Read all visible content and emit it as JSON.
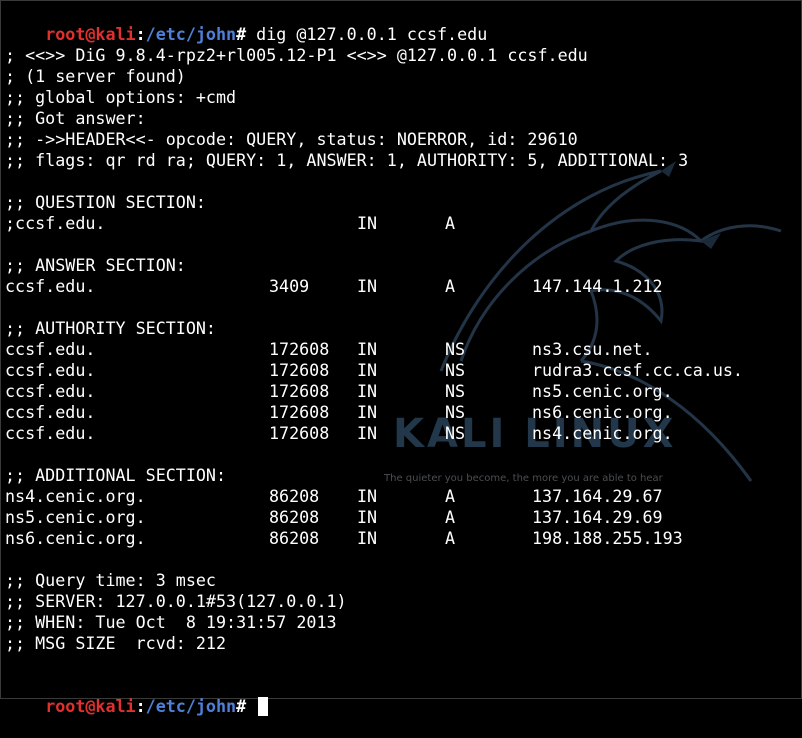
{
  "terminal": {
    "colors": {
      "background": "#000000",
      "text": "#ffffff",
      "prompt_user": "#e03030",
      "prompt_path": "#4f80d8"
    },
    "prompt": {
      "user_host": "root@kali",
      "separator": ":",
      "path": "/etc/john",
      "symbol": "# "
    },
    "command": "dig @127.0.0.1 ccsf.edu",
    "header_lines": [
      "; <<>> DiG 9.8.4-rpz2+rl005.12-P1 <<>> @127.0.0.1 ccsf.edu",
      "; (1 server found)",
      ";; global options: +cmd",
      ";; Got answer:",
      ";; ->>HEADER<<- opcode: QUERY, status: NOERROR, id: 29610",
      ";; flags: qr rd ra; QUERY: 1, ANSWER: 1, AUTHORITY: 5, ADDITIONAL: 3"
    ],
    "question_section": {
      "title": ";; QUESTION SECTION:",
      "row": {
        "name": ";ccsf.edu.",
        "class": "IN",
        "type": "A"
      }
    },
    "answer_section": {
      "title": ";; ANSWER SECTION:",
      "rows": [
        {
          "name": "ccsf.edu.",
          "ttl": "3409",
          "class": "IN",
          "type": "A",
          "data": "147.144.1.212"
        }
      ]
    },
    "authority_section": {
      "title": ";; AUTHORITY SECTION:",
      "rows": [
        {
          "name": "ccsf.edu.",
          "ttl": "172608",
          "class": "IN",
          "type": "NS",
          "data": "ns3.csu.net."
        },
        {
          "name": "ccsf.edu.",
          "ttl": "172608",
          "class": "IN",
          "type": "NS",
          "data": "rudra3.ccsf.cc.ca.us."
        },
        {
          "name": "ccsf.edu.",
          "ttl": "172608",
          "class": "IN",
          "type": "NS",
          "data": "ns5.cenic.org."
        },
        {
          "name": "ccsf.edu.",
          "ttl": "172608",
          "class": "IN",
          "type": "NS",
          "data": "ns6.cenic.org."
        },
        {
          "name": "ccsf.edu.",
          "ttl": "172608",
          "class": "IN",
          "type": "NS",
          "data": "ns4.cenic.org."
        }
      ]
    },
    "additional_section": {
      "title": ";; ADDITIONAL SECTION:",
      "rows": [
        {
          "name": "ns4.cenic.org.",
          "ttl": "86208",
          "class": "IN",
          "type": "A",
          "data": "137.164.29.67"
        },
        {
          "name": "ns5.cenic.org.",
          "ttl": "86208",
          "class": "IN",
          "type": "A",
          "data": "137.164.29.69"
        },
        {
          "name": "ns6.cenic.org.",
          "ttl": "86208",
          "class": "IN",
          "type": "A",
          "data": "198.188.255.193"
        }
      ]
    },
    "footer_lines": [
      ";; Query time: 3 msec",
      ";; SERVER: 127.0.0.1#53(127.0.0.1)",
      ";; WHEN: Tue Oct  8 19:31:57 2013",
      ";; MSG SIZE  rcvd: 212"
    ],
    "watermark": {
      "logo_text": "KALI LINUX",
      "tagline": "The quieter you become, the more you are able to hear",
      "icon": "kali-dragon-icon"
    }
  }
}
